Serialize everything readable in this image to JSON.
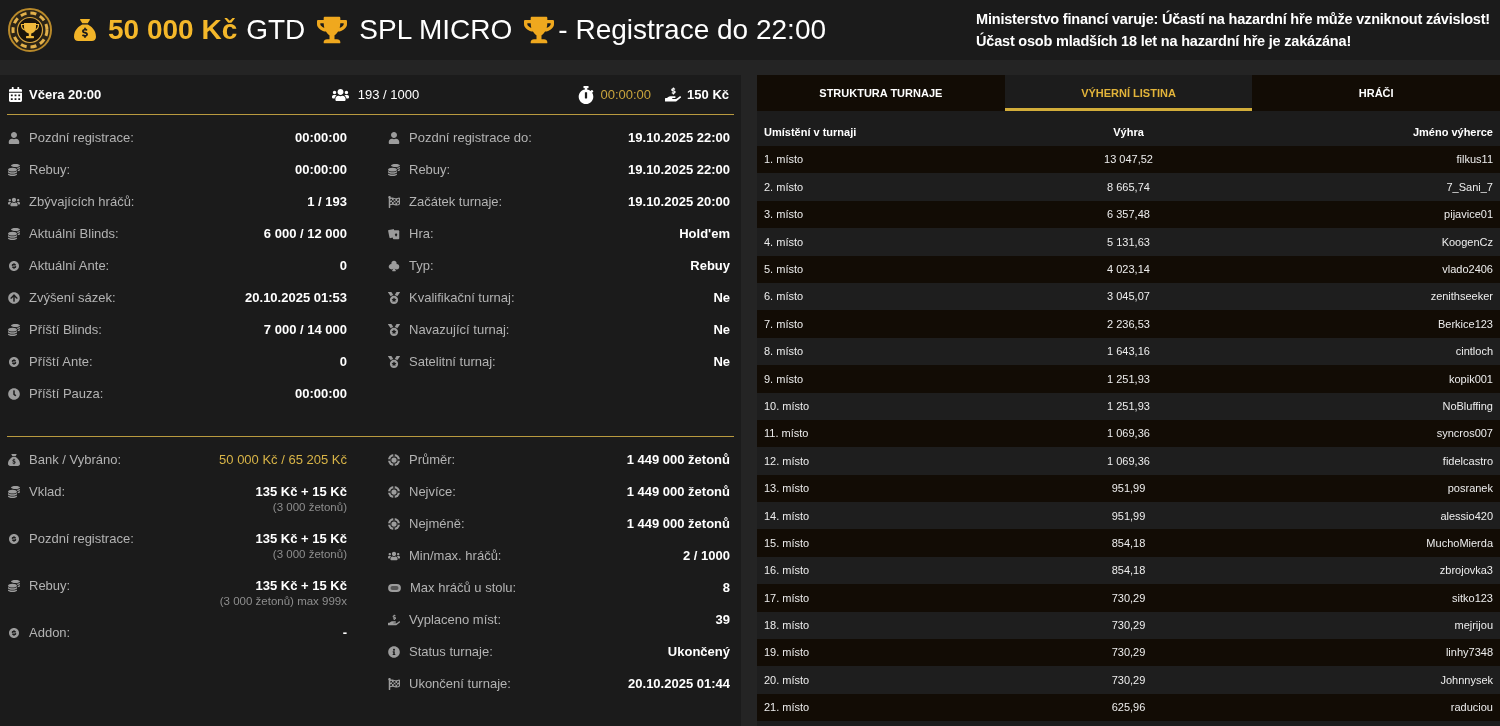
{
  "header": {
    "prize": "50 000 Kč",
    "guarantee": "GTD",
    "title": "SPL MICRO",
    "registration": "- Registrace do 22:00",
    "warning": [
      "Ministerstvo financí varuje: Účastí na hazardní hře může vzniknout závislost!",
      "Účast osob mladších 18 let na hazardní hře je zakázána!"
    ]
  },
  "summary": {
    "start": "Včera 20:00",
    "players": "193 / 1000",
    "timer": "00:00:00",
    "buy_in": "150 Kč"
  },
  "details": {
    "left": [
      {
        "label": "Pozdní registrace:",
        "value": "00:00:00"
      },
      {
        "label": "Rebuy:",
        "value": "00:00:00"
      },
      {
        "label": "Zbývajících hráčů:",
        "value": "1 / 193"
      },
      {
        "label": "Aktuální Blinds:",
        "value": "6 000 / 12 000"
      },
      {
        "label": "Aktuální Ante:",
        "value": "0"
      },
      {
        "label": "Zvýšení sázek:",
        "value": "20.10.2025 01:53"
      },
      {
        "label": "Příští Blinds:",
        "value": "7 000 / 14 000"
      },
      {
        "label": "Příští Ante:",
        "value": "0"
      },
      {
        "label": "Příští Pauza:",
        "value": "00:00:00"
      }
    ],
    "right": [
      {
        "label": "Pozdní registrace do:",
        "value": "19.10.2025 22:00"
      },
      {
        "label": "Rebuy:",
        "value": "19.10.2025 22:00"
      },
      {
        "label": "Začátek turnaje:",
        "value": "19.10.2025 20:00"
      },
      {
        "label": "Hra:",
        "value": "Hold'em"
      },
      {
        "label": "Typ:",
        "value": "Rebuy"
      },
      {
        "label": "Kvalifikační turnaj:",
        "value": "Ne"
      },
      {
        "label": "Navazující turnaj:",
        "value": "Ne"
      },
      {
        "label": "Satelitní turnaj:",
        "value": "Ne"
      }
    ]
  },
  "finance": {
    "left": [
      {
        "label": "Bank / Vybráno:",
        "value": "50 000 Kč / 65 205 Kč",
        "highlighted": true
      },
      {
        "label": "Vklad:",
        "value": "135 Kč + 15 Kč",
        "note": "(3 000 žetonů)",
        "highlighted": false
      },
      {
        "label": "Pozdní registrace:",
        "value": "135 Kč + 15 Kč",
        "note": "(3 000 žetonů)",
        "highlighted": false
      },
      {
        "label": "Rebuy:",
        "value": "135 Kč + 15 Kč",
        "note": "(3 000 žetonů) max 999x",
        "highlighted": false
      },
      {
        "label": "Addon:",
        "value": "-",
        "highlighted": false
      }
    ],
    "right": [
      {
        "label": "Průměr:",
        "value": "1 449 000 žetonů"
      },
      {
        "label": "Nejvíce:",
        "value": "1 449 000 žetonů"
      },
      {
        "label": "Nejméně:",
        "value": "1 449 000 žetonů"
      },
      {
        "label": "Min/max. hráčů:",
        "value": "2 / 1000"
      },
      {
        "label": "Max hráčů u stolu:",
        "value": "8"
      },
      {
        "label": "Vyplaceno míst:",
        "value": "39"
      },
      {
        "label": "Status turnaje:",
        "value": "Ukončený"
      },
      {
        "label": "Ukončení turnaje:",
        "value": "20.10.2025 01:44"
      }
    ]
  },
  "tabs": [
    {
      "label": "STRUKTURA TURNAJE",
      "selected": false
    },
    {
      "label": "VÝHERNÍ LISTINA",
      "selected": true
    },
    {
      "label": "HRÁČI",
      "selected": false
    }
  ],
  "payouts": {
    "columns": [
      "Umístění v turnaji",
      "Výhra",
      "Jméno výherce"
    ],
    "rows": [
      {
        "place": "1. místo",
        "prize": "13 047,52",
        "winner": "filkus11"
      },
      {
        "place": "2. místo",
        "prize": "8 665,74",
        "winner": "7_Sani_7"
      },
      {
        "place": "3. místo",
        "prize": "6 357,48",
        "winner": "pijavice01"
      },
      {
        "place": "4. místo",
        "prize": "5 131,63",
        "winner": "KoogenCz"
      },
      {
        "place": "5. místo",
        "prize": "4 023,14",
        "winner": "vlado2406"
      },
      {
        "place": "6. místo",
        "prize": "3 045,07",
        "winner": "zenithseeker"
      },
      {
        "place": "7. místo",
        "prize": "2 236,53",
        "winner": "Berkice123"
      },
      {
        "place": "8. místo",
        "prize": "1 643,16",
        "winner": "cintloch"
      },
      {
        "place": "9. místo",
        "prize": "1 251,93",
        "winner": "kopik001"
      },
      {
        "place": "10. místo",
        "prize": "1 251,93",
        "winner": "NoBluffing"
      },
      {
        "place": "11. místo",
        "prize": "1 069,36",
        "winner": "syncros007"
      },
      {
        "place": "12. místo",
        "prize": "1 069,36",
        "winner": "fidelcastro"
      },
      {
        "place": "13. místo",
        "prize": "951,99",
        "winner": "posranek"
      },
      {
        "place": "14. místo",
        "prize": "951,99",
        "winner": "alessio420"
      },
      {
        "place": "15. místo",
        "prize": "854,18",
        "winner": "MuchoMierda"
      },
      {
        "place": "16. místo",
        "prize": "854,18",
        "winner": "zbrojovka3"
      },
      {
        "place": "17. místo",
        "prize": "730,29",
        "winner": "sitko123"
      },
      {
        "place": "18. místo",
        "prize": "730,29",
        "winner": "mejrijou"
      },
      {
        "place": "19. místo",
        "prize": "730,29",
        "winner": "linhy7348"
      },
      {
        "place": "20. místo",
        "prize": "730,29",
        "winner": "Johnnysek"
      },
      {
        "place": "21. místo",
        "prize": "625,96",
        "winner": "raduciou"
      }
    ]
  }
}
